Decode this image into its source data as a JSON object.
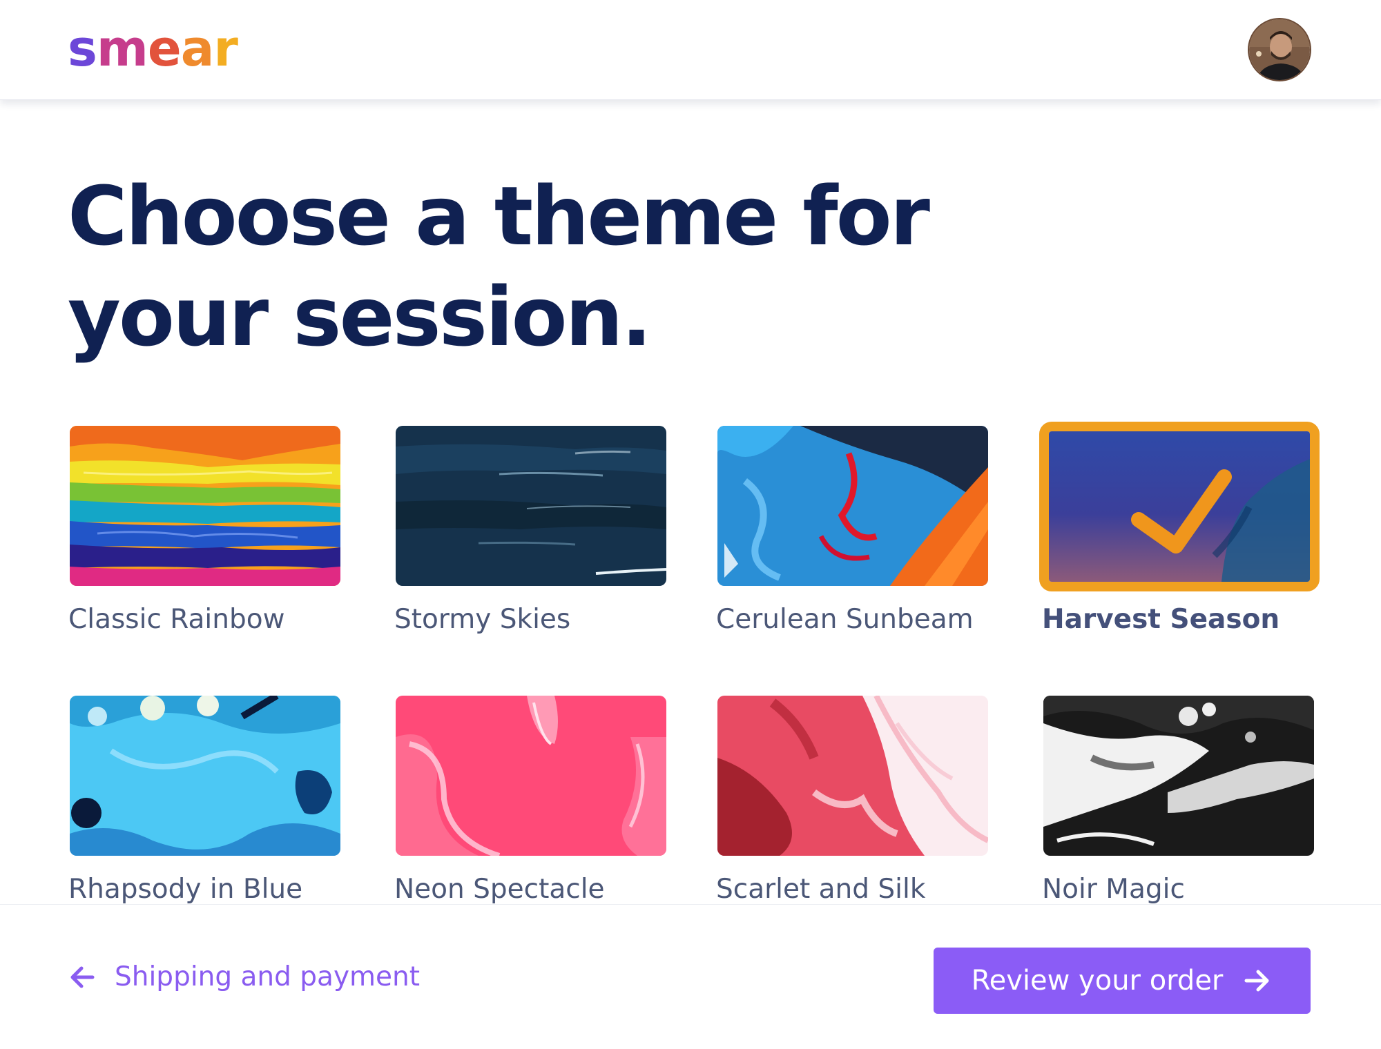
{
  "header": {
    "logo_letters": [
      "s",
      "m",
      "e",
      "a",
      "r"
    ],
    "avatar_icon": "user-avatar-photo"
  },
  "main": {
    "title_line1": "Choose a theme for",
    "title_line2": "your session.",
    "themes": [
      {
        "label": "Classic Rainbow",
        "selected": false
      },
      {
        "label": "Stormy Skies",
        "selected": false
      },
      {
        "label": "Cerulean Sunbeam",
        "selected": false
      },
      {
        "label": "Harvest Season",
        "selected": true
      },
      {
        "label": "Rhapsody in Blue",
        "selected": false
      },
      {
        "label": "Neon Spectacle",
        "selected": false
      },
      {
        "label": "Scarlet and Silk",
        "selected": false
      },
      {
        "label": "Noir Magic",
        "selected": false
      }
    ]
  },
  "footer": {
    "back_label": "Shipping and payment",
    "next_label": "Review your order"
  },
  "colors": {
    "title": "#102152",
    "accent_purple": "#8b5cf6",
    "selected_border": "#f0a020"
  },
  "icons": {
    "back": "arrow-left-icon",
    "next": "arrow-right-icon",
    "selected": "checkmark-icon"
  }
}
